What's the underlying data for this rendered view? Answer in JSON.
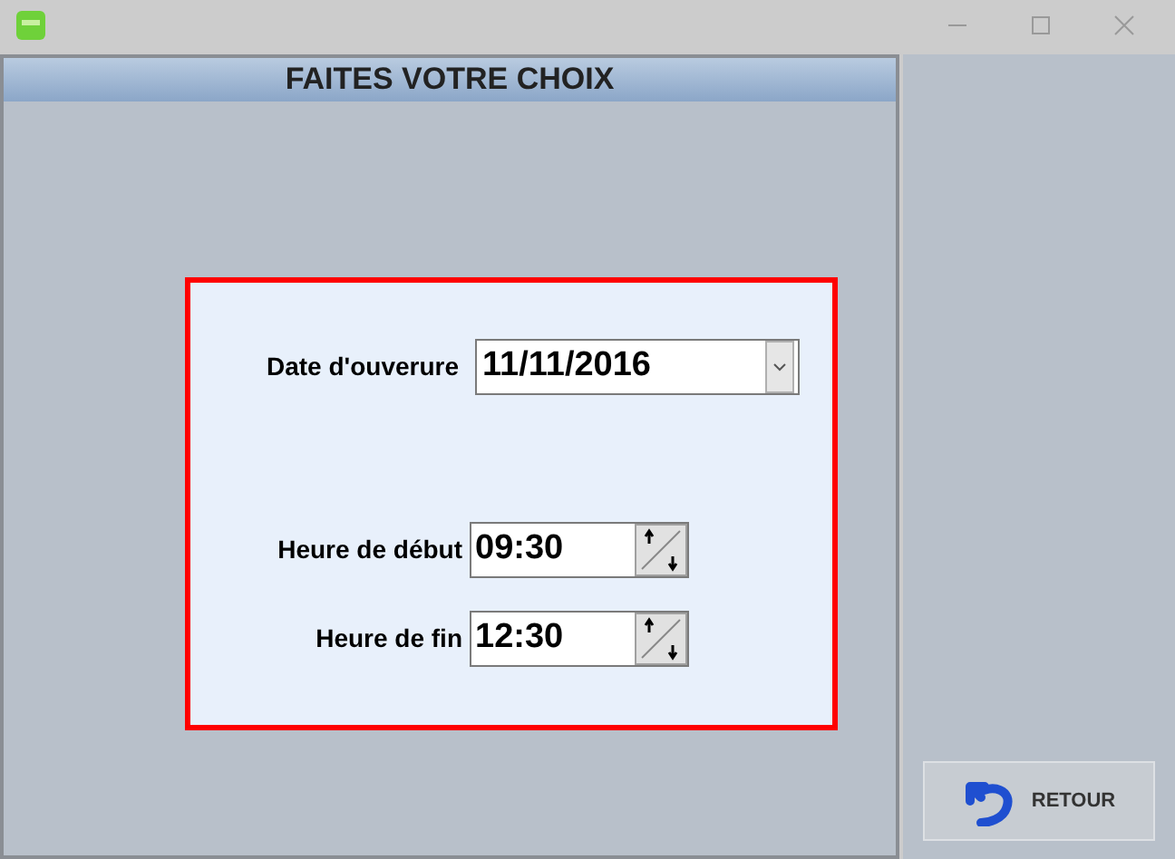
{
  "panel": {
    "title": "FAITES VOTRE CHOIX"
  },
  "dialog": {
    "date": {
      "label": "Date d'ouverure",
      "value": "11/11/2016"
    },
    "times": [
      {
        "label": "Heure de début",
        "value": "09:30"
      },
      {
        "label": "Heure de fin",
        "value": "12:30"
      }
    ]
  },
  "back_button": {
    "label": "RETOUR"
  }
}
